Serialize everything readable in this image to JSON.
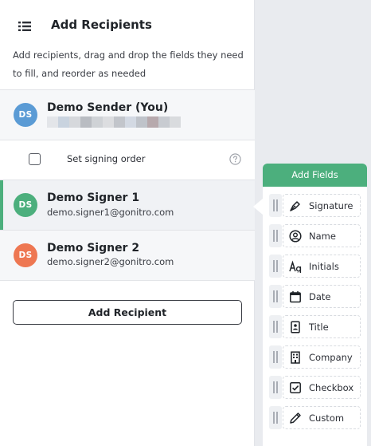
{
  "header": {
    "title": "Add Recipients",
    "description": "Add recipients, drag and drop the fields they need to fill, and reorder as needed"
  },
  "sender": {
    "initials": "DS",
    "name": "Demo Sender (You)",
    "avatar_color": "#5b9bd5"
  },
  "signing_order": {
    "label": "Set signing order",
    "checked": false
  },
  "signers": [
    {
      "initials": "DS",
      "name": "Demo Signer 1",
      "email": "demo.signer1@gonitro.com",
      "avatar_color": "#4caf7d",
      "active": true
    },
    {
      "initials": "DS",
      "name": "Demo Signer 2",
      "email": "demo.signer2@gonitro.com",
      "avatar_color": "#ee7752",
      "active": false
    }
  ],
  "add_recipient_label": "Add Recipient",
  "fields_panel": {
    "title": "Add Fields",
    "accent_color": "#4caf7d",
    "items": [
      {
        "label": "Signature",
        "icon": "pen-nib-icon"
      },
      {
        "label": "Name",
        "icon": "user-circle-icon"
      },
      {
        "label": "Initials",
        "icon": "initials-icon"
      },
      {
        "label": "Date",
        "icon": "calendar-icon"
      },
      {
        "label": "Title",
        "icon": "id-badge-icon"
      },
      {
        "label": "Company",
        "icon": "building-icon"
      },
      {
        "label": "Checkbox",
        "icon": "checkbox-icon"
      },
      {
        "label": "Custom",
        "icon": "pencil-icon"
      }
    ]
  }
}
